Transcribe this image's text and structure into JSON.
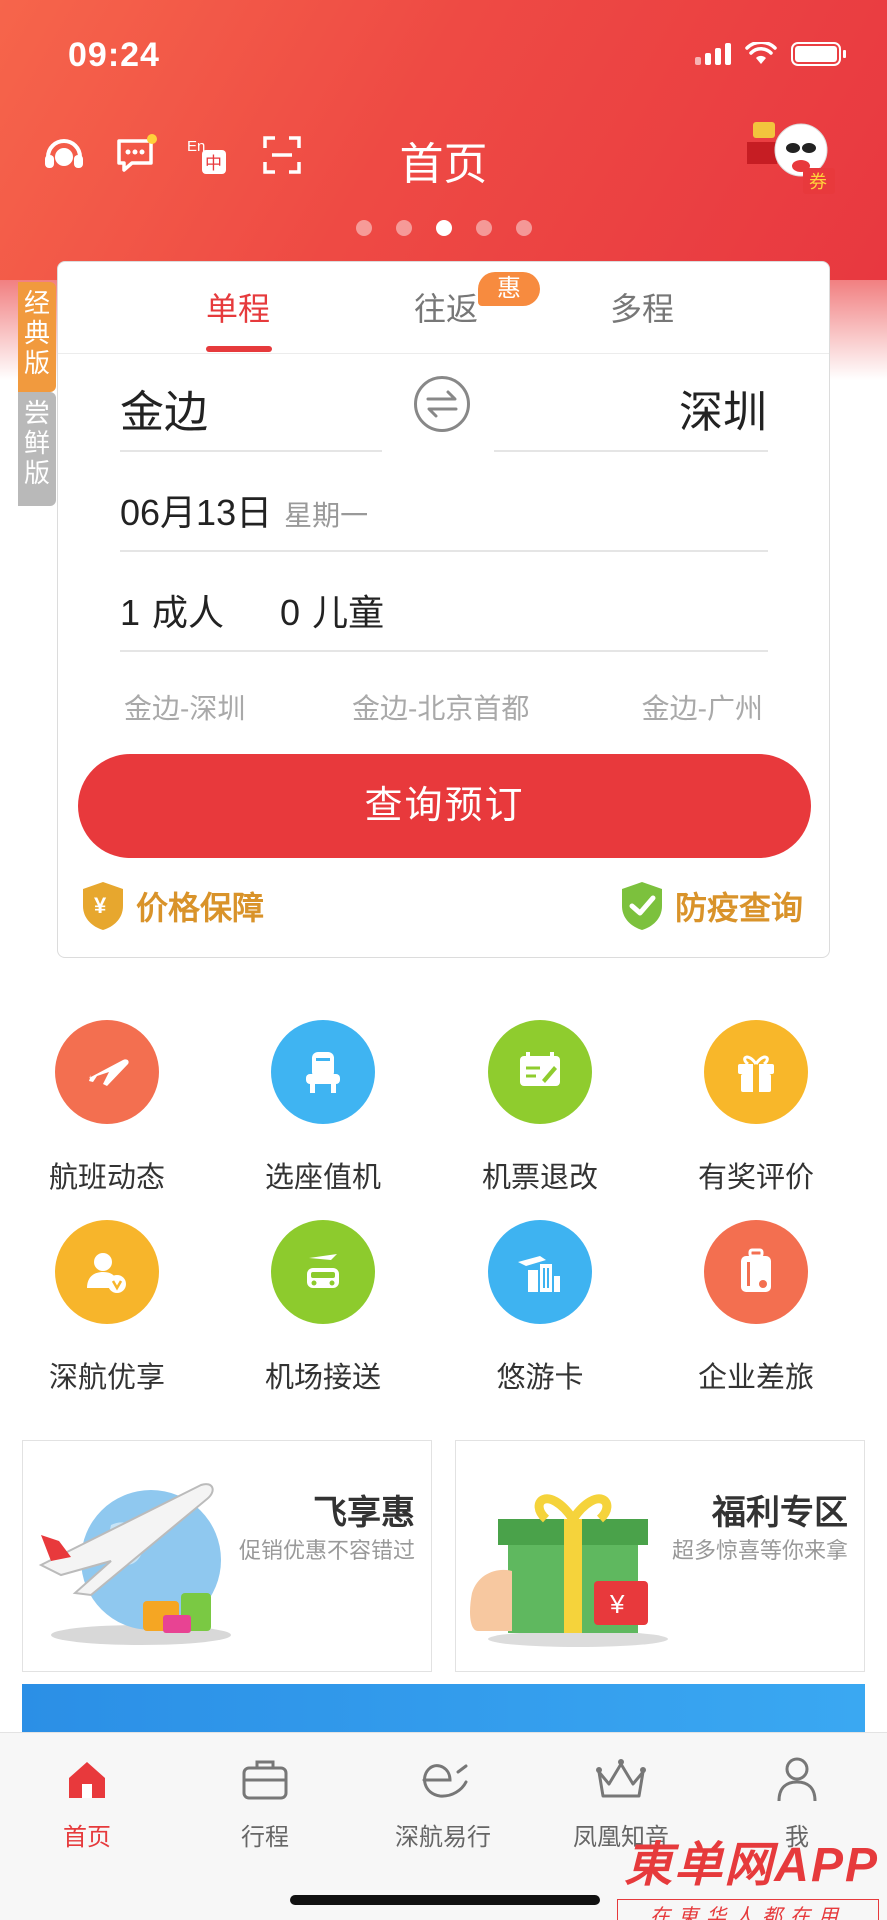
{
  "status_bar": {
    "time": "09:24"
  },
  "header": {
    "title": "首页",
    "lang_icon_top": "En",
    "lang_icon_bottom": "中",
    "mascot_text": "券",
    "carousel_count": 5,
    "carousel_active": 3
  },
  "side_tabs": {
    "classic": "经典版",
    "new": "尝鲜版"
  },
  "booking": {
    "tabs": [
      "单程",
      "往返",
      "多程"
    ],
    "active_tab": "单程",
    "roundtrip_badge": "惠",
    "from_city": "金边",
    "to_city": "深圳",
    "date": "06月13日",
    "weekday": "星期一",
    "adults_count": "1",
    "adults_label": "成人",
    "children_count": "0",
    "children_label": "儿童",
    "history": [
      "金边-深圳",
      "金边-北京首都",
      "金边-广州"
    ],
    "search_button": "查询预订",
    "price_guarantee": "价格保障",
    "price_guarantee_icon_text": "¥",
    "epidemic_query": "防疫查询"
  },
  "services": [
    {
      "label": "航班动态",
      "icon": "plane-icon",
      "color": "#f36f50"
    },
    {
      "label": "选座值机",
      "icon": "seat-icon",
      "color": "#3fb4f2"
    },
    {
      "label": "机票退改",
      "icon": "ticket-edit-icon",
      "color": "#8fcc2e"
    },
    {
      "label": "有奖评价",
      "icon": "gift-box-icon",
      "color": "#f8b72a"
    },
    {
      "label": "深航优享",
      "icon": "vip-user-icon",
      "color": "#f7b52b"
    },
    {
      "label": "机场接送",
      "icon": "car-icon",
      "color": "#8dcb2d"
    },
    {
      "label": "悠游卡",
      "icon": "city-plane-icon",
      "color": "#3eb3f1"
    },
    {
      "label": "企业差旅",
      "icon": "luggage-icon",
      "color": "#f36f50"
    }
  ],
  "promos": [
    {
      "title": "飞享惠",
      "subtitle": "促销优惠不容错过"
    },
    {
      "title": "福利专区",
      "subtitle": "超多惊喜等你来拿"
    }
  ],
  "promo_art": {
    "currency": "¥"
  },
  "bottom_nav": [
    {
      "label": "首页",
      "icon": "home-icon",
      "active": true
    },
    {
      "label": "行程",
      "icon": "briefcase-icon",
      "active": false
    },
    {
      "label": "深航易行",
      "icon": "swirl-e-icon",
      "active": false
    },
    {
      "label": "凤凰知音",
      "icon": "crown-icon",
      "active": false
    },
    {
      "label": "我",
      "icon": "profile-icon",
      "active": false
    }
  ],
  "watermark": {
    "main": "東单网APP",
    "sub": "在東华人都在用"
  },
  "colors": {
    "brand_red": "#e8393c",
    "accent_orange": "#f19a3e",
    "gold": "#d9932a"
  }
}
